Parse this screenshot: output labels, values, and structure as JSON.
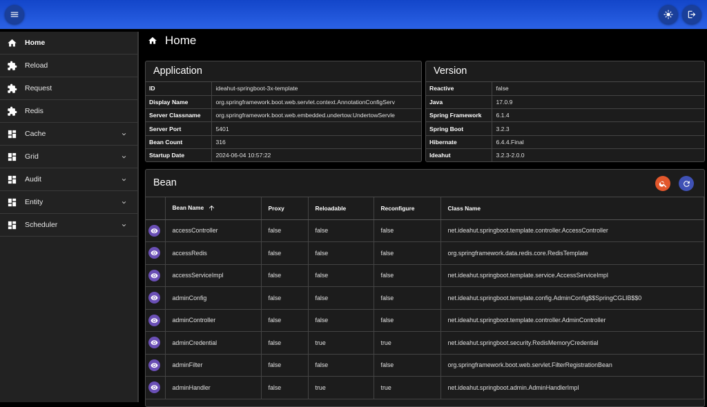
{
  "topbar": {
    "menu_icon": "menu-icon",
    "theme_icon": "sun-icon",
    "logout_icon": "logout-icon"
  },
  "sidebar": {
    "items": [
      {
        "label": "Home",
        "icon": "home-icon",
        "active": true
      },
      {
        "label": "Reload",
        "icon": "puzzle-icon"
      },
      {
        "label": "Request",
        "icon": "puzzle-icon"
      },
      {
        "label": "Redis",
        "icon": "puzzle-icon"
      },
      {
        "label": "Cache",
        "icon": "dashboard-icon",
        "expandable": true
      },
      {
        "label": "Grid",
        "icon": "dashboard-icon",
        "expandable": true
      },
      {
        "label": "Audit",
        "icon": "dashboard-icon",
        "expandable": true
      },
      {
        "label": "Entity",
        "icon": "dashboard-icon",
        "expandable": true
      },
      {
        "label": "Scheduler",
        "icon": "dashboard-icon",
        "expandable": true
      }
    ]
  },
  "page": {
    "title": "Home"
  },
  "application": {
    "title": "Application",
    "rows": [
      {
        "key": "ID",
        "value": "ideahut-springboot-3x-template"
      },
      {
        "key": "Display Name",
        "value": "org.springframework.boot.web.servlet.context.AnnotationConfigServ"
      },
      {
        "key": "Server Classname",
        "value": "org.springframework.boot.web.embedded.undertow.UndertowServle"
      },
      {
        "key": "Server Port",
        "value": "5401"
      },
      {
        "key": "Bean Count",
        "value": "316"
      },
      {
        "key": "Startup Date",
        "value": "2024-06-04 10:57:22"
      }
    ]
  },
  "version": {
    "title": "Version",
    "rows": [
      {
        "key": "Reactive",
        "value": "false"
      },
      {
        "key": "Java",
        "value": "17.0.9"
      },
      {
        "key": "Spring Framework",
        "value": "6.1.4"
      },
      {
        "key": "Spring Boot",
        "value": "3.2.3"
      },
      {
        "key": "Hibernate",
        "value": "6.4.4.Final"
      },
      {
        "key": "Ideahut",
        "value": "3.2.3-2.0.0"
      }
    ]
  },
  "bean": {
    "title": "Bean",
    "search_color": "#e2572c",
    "refresh_color": "#3f51b5",
    "columns": [
      "Bean Name",
      "Proxy",
      "Reloadable",
      "Reconfigure",
      "Class Name"
    ],
    "rows": [
      [
        "accessController",
        "false",
        "false",
        "false",
        "net.ideahut.springboot.template.controller.AccessController"
      ],
      [
        "accessRedis",
        "false",
        "false",
        "false",
        "org.springframework.data.redis.core.RedisTemplate"
      ],
      [
        "accessServiceImpl",
        "false",
        "false",
        "false",
        "net.ideahut.springboot.template.service.AccessServiceImpl"
      ],
      [
        "adminConfig",
        "false",
        "false",
        "false",
        "net.ideahut.springboot.template.config.AdminConfig$$SpringCGLIB$$0"
      ],
      [
        "adminController",
        "false",
        "false",
        "false",
        "net.ideahut.springboot.template.controller.AdminController"
      ],
      [
        "adminCredential",
        "false",
        "true",
        "true",
        "net.ideahut.springboot.security.RedisMemoryCredential"
      ],
      [
        "adminFilter",
        "false",
        "false",
        "false",
        "org.springframework.boot.web.servlet.FilterRegistrationBean"
      ],
      [
        "adminHandler",
        "false",
        "true",
        "true",
        "net.ideahut.springboot.admin.AdminHandlerImpl"
      ]
    ]
  }
}
